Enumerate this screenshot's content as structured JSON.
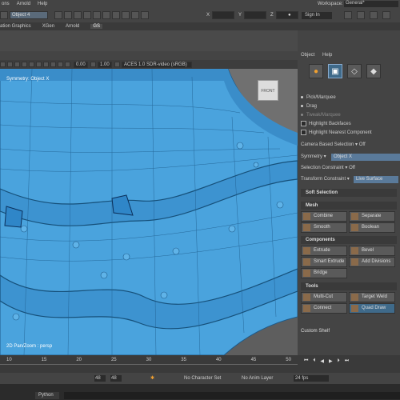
{
  "menubar": {
    "items": [
      "ons",
      "Arnold",
      "Help"
    ],
    "workspace_label": "Workspace:",
    "workspace_value": "General*"
  },
  "statusline": {
    "object_field": "Object 4",
    "sign_in": "Sign In",
    "x_label": "X",
    "y_label": "Y",
    "z_label": "Z"
  },
  "shelf_tabs": [
    "ation Graphics",
    "XGen",
    "Arnold",
    "GS"
  ],
  "viewport": {
    "tool_values": [
      "0.00",
      "1.00"
    ],
    "color_space": "ACES 1.0 SDR-video (sRGB)",
    "symmetry_label": "Symmetry: Object X",
    "camera_label": "2D Pan/Zoom : persp",
    "viewcube_label": "FRONT"
  },
  "right_panel": {
    "tabs": [
      "Object",
      "Help"
    ],
    "options": [
      {
        "label": "Pick/Marquee",
        "type": "radio"
      },
      {
        "label": "Drag",
        "type": "radio"
      },
      {
        "label": "Tweak/Marquee",
        "type": "radio"
      },
      {
        "label": "Highlight Backfaces",
        "type": "check"
      },
      {
        "label": "Highlight Nearest Component",
        "type": "check"
      }
    ],
    "camera_based": {
      "label": "Camera Based Selection",
      "value": "Off"
    },
    "symmetry": {
      "label": "Symmetry",
      "value": "Object X"
    },
    "selection_constraint": {
      "label": "Selection Constraint",
      "value": "Off"
    },
    "transform_constraint": {
      "label": "Transform Constraint",
      "value": "Live Surface"
    },
    "soft_selection": "Soft Selection",
    "mesh": {
      "header": "Mesh",
      "buttons": [
        "Combine",
        "Separate",
        "Smooth",
        "Boolean"
      ]
    },
    "components": {
      "header": "Components",
      "buttons": [
        "Extrude",
        "Bevel",
        "Smart Extrude",
        "Add Divisions",
        "Bridge"
      ]
    },
    "tools": {
      "header": "Tools",
      "buttons": [
        "Multi-Cut",
        "Target Weld",
        "Connect",
        "Quad Draw"
      ]
    },
    "custom_shelf": "Custom Shelf"
  },
  "timeline": {
    "ticks": [
      "10",
      "15",
      "20",
      "25",
      "30",
      "35",
      "40",
      "45",
      "50"
    ]
  },
  "range": {
    "start": "48",
    "end": "48",
    "character_set": "No Character Set",
    "anim_layer": "No Anim Layer",
    "fps": "24 fps"
  },
  "script": {
    "label": "Python"
  }
}
